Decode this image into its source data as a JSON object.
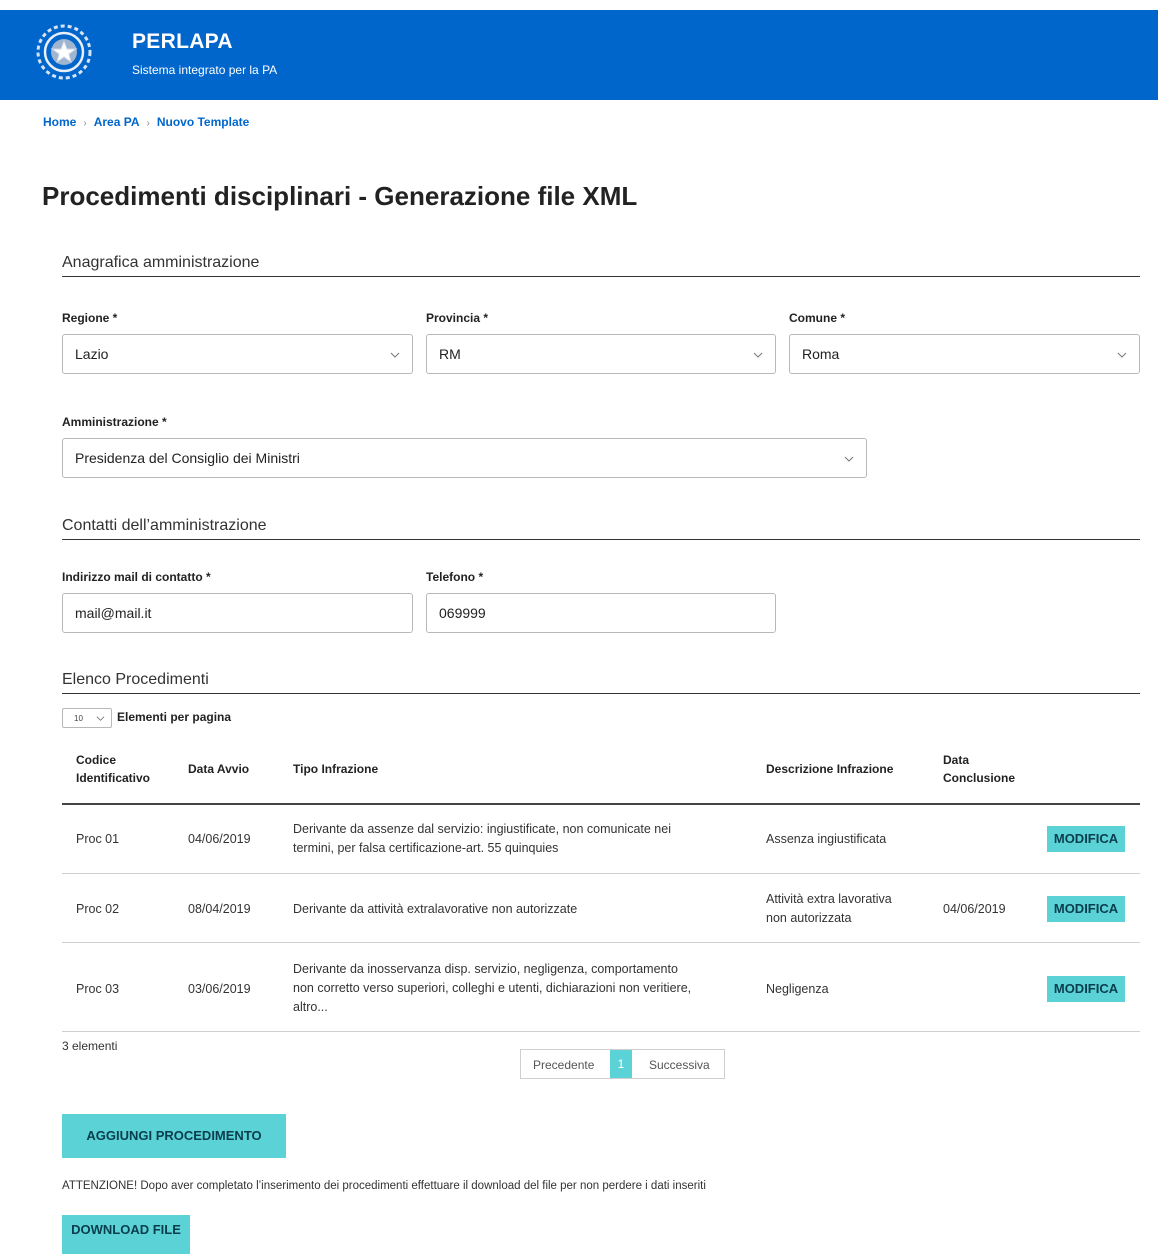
{
  "header": {
    "title": "PERLAPA",
    "subtitle": "Sistema integrato per la PA",
    "bg_color": "#0066cc",
    "emblem_icon": "italian-republic-emblem"
  },
  "breadcrumb": [
    "Home",
    "Area PA",
    "Nuovo Template"
  ],
  "page_title": "Procedimenti disciplinari - Generazione file XML",
  "anagrafica": {
    "heading": "Anagrafica amministrazione",
    "regione": {
      "label": "Regione *",
      "value": "Lazio"
    },
    "provincia": {
      "label": "Provincia *",
      "value": "RM"
    },
    "comune": {
      "label": "Comune *",
      "value": "Roma"
    },
    "amministrazione": {
      "label": "Amministrazione *",
      "value": "Presidenza del Consiglio dei Ministri"
    }
  },
  "contatti": {
    "heading": "Contatti dell’amministrazione",
    "email": {
      "label": "Indirizzo mail di contatto *",
      "value": "mail@mail.it"
    },
    "telefono": {
      "label": "Telefono *",
      "value": "069999"
    }
  },
  "elenco": {
    "heading": "Elenco Procedimenti",
    "per_page": {
      "value": "10",
      "label": "Elementi per pagina"
    },
    "columns": [
      {
        "line1": "Codice",
        "line2": "Identificativo"
      },
      {
        "line1": "Data Avvio",
        "line2": ""
      },
      {
        "line1": "Tipo Infrazione",
        "line2": ""
      },
      {
        "line1": "Descrizione Infrazione",
        "line2": ""
      },
      {
        "line1": "Data",
        "line2": "Conclusione"
      }
    ],
    "rows": [
      {
        "code": "Proc 01",
        "start": "04/06/2019",
        "tipo": [
          "Derivante da assenze dal servizio: ingiustificate, non comunicate nei",
          "termini, per falsa certificazione-art. 55 quinquies"
        ],
        "descr": [
          "Assenza ingiustificata"
        ],
        "end": "",
        "action": "MODIFICA"
      },
      {
        "code": "Proc 02",
        "start": "08/04/2019",
        "tipo": [
          "Derivante da attività extralavorative non autorizzate"
        ],
        "descr": [
          "Attività extra lavorativa",
          "non autorizzata"
        ],
        "end": "04/06/2019",
        "action": "MODIFICA"
      },
      {
        "code": "Proc 03",
        "start": "03/06/2019",
        "tipo": [
          "Derivante da inosservanza disp. servizio, negligenza, comportamento",
          "non corretto verso superiori, colleghi e utenti, dichiarazioni non veritiere,",
          "altro..."
        ],
        "descr": [
          "Negligenza"
        ],
        "end": "",
        "action": "MODIFICA"
      }
    ],
    "count_text": "3 elementi",
    "pagination": {
      "prev": "Precedente",
      "current": "1",
      "next": "Successiva"
    }
  },
  "actions": {
    "add_label": "AGGIUNGI PROCEDIMENTO",
    "warning": "ATTENZIONE! Dopo aver completato l’inserimento dei procedimenti effettuare il download del file per non perdere i dati inseriti",
    "download_label": "DOWNLOAD FILE"
  },
  "colors": {
    "accent": "#5bd3d6",
    "primary": "#0066cc"
  }
}
